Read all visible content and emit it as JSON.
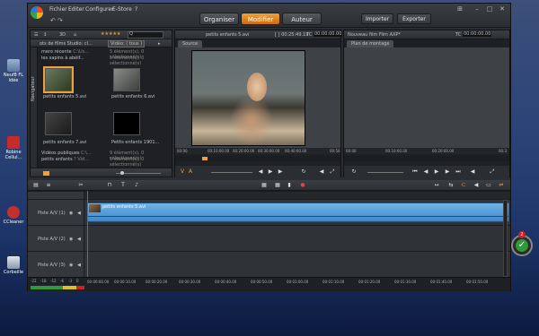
{
  "desktop": {
    "icons": [
      {
        "label": "Neuf8 FL ldée"
      },
      {
        "label": "Robine Cellul..."
      },
      {
        "label": "CCleaner"
      },
      {
        "label": "Corbeille"
      }
    ]
  },
  "app": {
    "menu": [
      "Fichier",
      "Editer",
      "Configurer",
      "E-Store",
      "?"
    ],
    "tabs": [
      "Organiser",
      "Modifier",
      "Auteur"
    ],
    "import_label": "Importer",
    "export_label": "Exporter",
    "colors": {
      "accent": "#f0a03a",
      "window": "#2a2d31"
    }
  },
  "library": {
    "breadcrumb": "ots de films Studio: cl...",
    "filter": "Vidéo: ( tous )",
    "toolbar": {
      "view_3d": "3D",
      "rating": "★★★★★"
    },
    "side_label": "Navigateur",
    "tree": [
      {
        "name": "mero récente",
        "info": "C:\\Us..."
      },
      {
        "name": "les sapins à abéif...",
        "info": ""
      }
    ],
    "counts": [
      "5 élément(s), 0 sélectionné(s)",
      "5 élément(s), 0 sélectionné(s)"
    ],
    "thumbs": [
      {
        "label": "petits enfants 5.avi"
      },
      {
        "label": "petits enfants 6.avi"
      },
      {
        "label": "petits enfants 7.avi"
      },
      {
        "label": "Petits enfants 1901..."
      }
    ],
    "bottom_items": [
      {
        "name": "Vidéos publiques",
        "info": "C:\\...",
        "count": "9 élément(s), 0 sélectionné(s)"
      },
      {
        "name": "petits enfants",
        "info": "? Vid...",
        "count": "5 élément(s), 0 sélectionné(s)"
      }
    ]
  },
  "source_player": {
    "filename": "petits enfants 5.avi",
    "timecode_in": "[ ] 00:25:49.19",
    "tc_label": "TC",
    "timecode": "00:00:00.00",
    "tab": "Source",
    "ruler": [
      "00:00",
      "00:10:00.00",
      "00:20:00.00",
      "00:30:00.00",
      "00:40:00.00",
      "00:50"
    ]
  },
  "program_player": {
    "title": "Nouveau film Film AXP*",
    "tc_label": "TC",
    "timecode": "00:00:00.00",
    "tab": "Plan de montage",
    "ruler": [
      "00:00",
      "00:10:00.00",
      "00:20:00.00",
      "00:3"
    ]
  },
  "timeline": {
    "tracks": [
      {
        "name": "Piste A/V (1)"
      },
      {
        "name": "Piste A/V (2)"
      },
      {
        "name": "Piste A/V (3)"
      }
    ],
    "clip_label": "petits enfants 5.avi",
    "ruler": [
      "00:00:00.00",
      "00:00:10.00",
      "00:00:20.00",
      "00:00:30.00",
      "00:00:40.00",
      "00:00:50.00",
      "00:01:00.00",
      "00:01:10.00",
      "00:01:20.00",
      "00:01:30.00",
      "00:01:40.00",
      "00:01:50.00"
    ],
    "meter": [
      "-22",
      "-18",
      "-12",
      "-6",
      "-3",
      "0"
    ]
  },
  "tray": {
    "badge": "2"
  }
}
